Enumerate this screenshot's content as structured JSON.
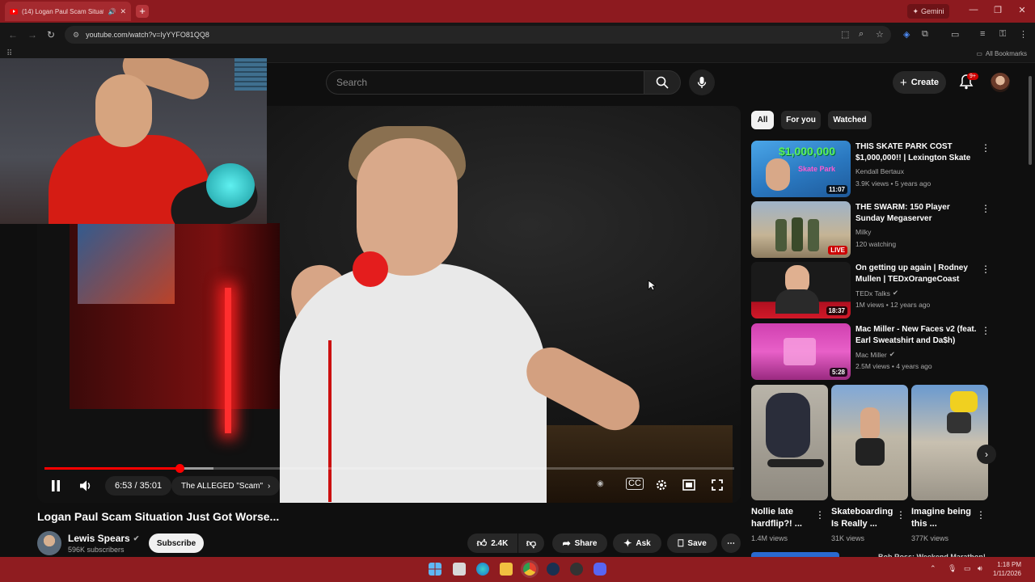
{
  "browser": {
    "tab_title": "(14) Logan Paul Scam Situat",
    "new_tab": "+",
    "gemini_label": "Gemini",
    "url": "youtube.com/watch?v=IyYYFO81QQ8",
    "all_bookmarks": "All Bookmarks",
    "window_controls": {
      "minimize": "—",
      "restore": "❐",
      "close": "✕"
    }
  },
  "header": {
    "search_placeholder": "Search",
    "create_label": "Create",
    "notifications_badge": "9+"
  },
  "player": {
    "progress": {
      "played_fraction": 0.196,
      "loaded_fraction": 0.245
    },
    "time_current": "6:53",
    "time_total": "35:01",
    "time_separator": " / ",
    "chapter": "The ALLEGED \"Scam\""
  },
  "video": {
    "title": "Logan Paul Scam Situation Just Got Worse...",
    "channel": "Lewis Spears",
    "subscribers": "596K subscribers",
    "subscribe_label": "Subscribe",
    "likes": "2.4K",
    "share_label": "Share",
    "ask_label": "Ask",
    "save_label": "Save"
  },
  "filters": [
    "All",
    "For you",
    "Watched"
  ],
  "recommendations": [
    {
      "title": "THIS SKATE PARK COST $1,000,000!! | Lexington Skate ...",
      "channel": "Kendall Bertaux",
      "verified": false,
      "meta": "3.9K views • 5 years ago",
      "badge": "11:07",
      "live": false,
      "thumb_text": "$1,000,000",
      "thumb_text2": "Skate Park"
    },
    {
      "title": "THE SWARM: 150 Player Sunday Megaserver",
      "channel": "Milky",
      "verified": false,
      "meta": "120 watching",
      "badge": "LIVE",
      "live": true
    },
    {
      "title": "On getting up again | Rodney Mullen | TEDxOrangeCoast",
      "channel": "TEDx Talks",
      "verified": true,
      "meta": "1M views • 12 years ago",
      "badge": "18:37",
      "live": false
    },
    {
      "title": "Mac Miller - New Faces v2 (feat. Earl Sweatshirt and Da$h)",
      "channel": "Mac Miller",
      "verified": true,
      "meta": "2.5M views • 4 years ago",
      "badge": "5:28",
      "live": false
    }
  ],
  "shorts": [
    {
      "title": "Nollie late hardflip?! ...",
      "views": "1.4M views"
    },
    {
      "title": "Skateboarding Is Really ...",
      "views": "31K views"
    },
    {
      "title": "Imagine being this ...",
      "views": "377K views"
    }
  ],
  "partial_next_title": "Bob Ross: Weekend Marathon!",
  "taskbar": {
    "time": "1:18 PM",
    "date": "1/11/2026"
  },
  "colors": {
    "chrome_red": "#8d1a1f",
    "youtube_red": "#ff0000",
    "page_bg": "#0f0f0f"
  }
}
